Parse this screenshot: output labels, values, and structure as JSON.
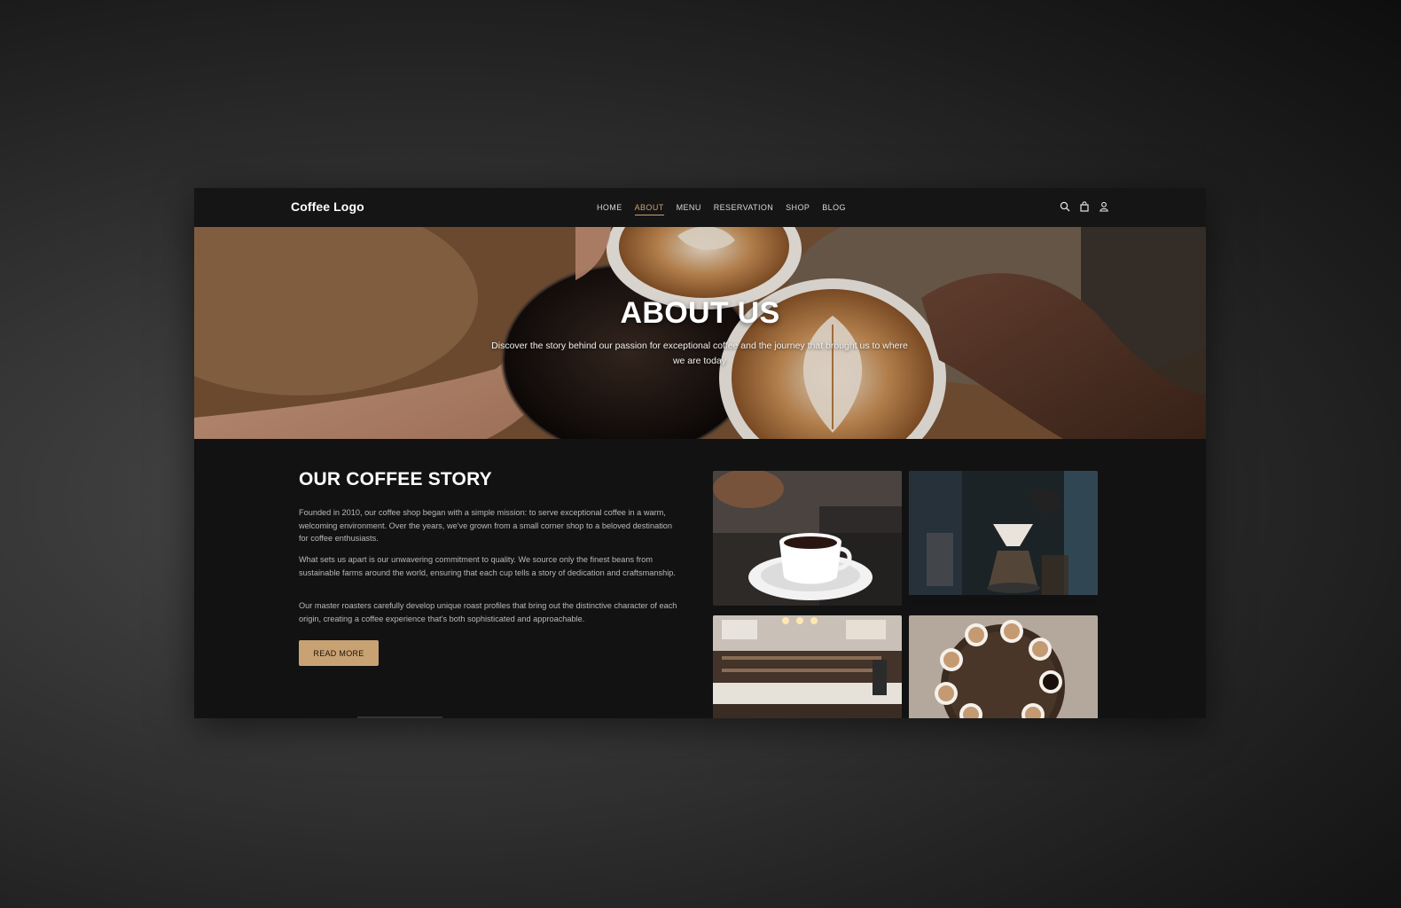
{
  "nav": {
    "logo": "Coffee Logo",
    "items": [
      {
        "label": "HOME",
        "active": false
      },
      {
        "label": "ABOUT",
        "active": true
      },
      {
        "label": "MENU",
        "active": false
      },
      {
        "label": "RESERVATION",
        "active": false
      },
      {
        "label": "SHOP",
        "active": false
      },
      {
        "label": "BLOG",
        "active": false
      }
    ],
    "icons": [
      "search-icon",
      "shopping-bag-icon",
      "user-icon"
    ]
  },
  "hero": {
    "title": "ABOUT US",
    "subtitle": "Discover the story behind our passion for exceptional coffee and the journey that brought us to where we are today"
  },
  "story": {
    "heading": "OUR COFFEE STORY",
    "paragraphs": [
      "Founded in 2010, our coffee shop began with a simple mission: to serve exceptional coffee in a warm, welcoming environment. Over the years, we've grown from a small corner shop to a beloved destination for coffee enthusiasts.",
      "What sets us apart is our unwavering commitment to quality. We source only the finest beans from sustainable farms around the world, ensuring that each cup tells a story of dedication and craftsmanship.",
      "Our master roasters carefully develop unique roast profiles that bring out the distinctive character of each origin, creating a coffee experience that's both sophisticated and approachable."
    ],
    "button": "READ MORE"
  },
  "colors": {
    "accent": "#c8a273",
    "background": "#121212",
    "nav_background": "#151515"
  }
}
